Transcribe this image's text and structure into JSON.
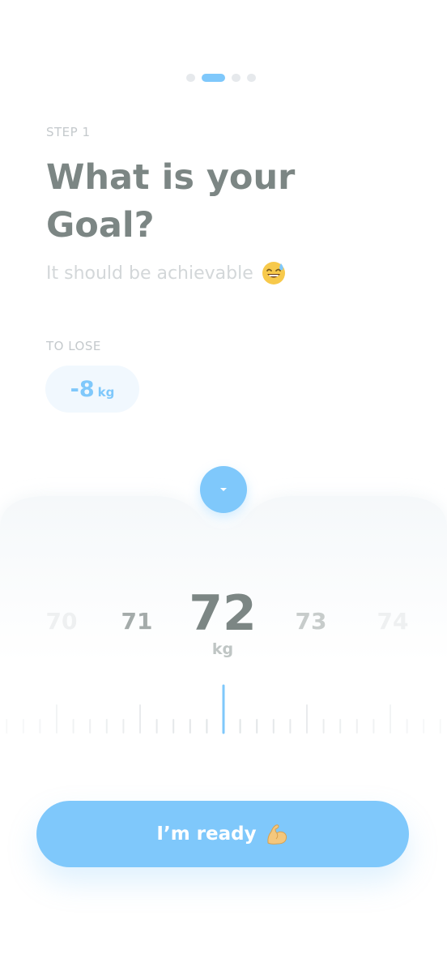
{
  "pager": {
    "total": 4,
    "active_index": 1
  },
  "header": {
    "step_label": "STEP 1",
    "title": "What is your Goal?",
    "subtitle": "It should be achievable"
  },
  "goal": {
    "label": "TO LOSE",
    "value": "-8",
    "unit": "kg"
  },
  "picker": {
    "values": [
      "70",
      "71",
      "72",
      "73",
      "74"
    ],
    "selected": "72",
    "unit": "kg"
  },
  "cta": {
    "label": "I’m ready"
  },
  "icons": {
    "subtitle_emoji": "grinning-sweat-emoji-icon",
    "cta_emoji": "flexed-biceps-emoji-icon",
    "drop_button": "caret-down-icon"
  },
  "colors": {
    "accent": "#7fc8fb",
    "title": "#7c8684",
    "muted": "#c4c9cc",
    "pill_bg": "#f1f8fe"
  }
}
